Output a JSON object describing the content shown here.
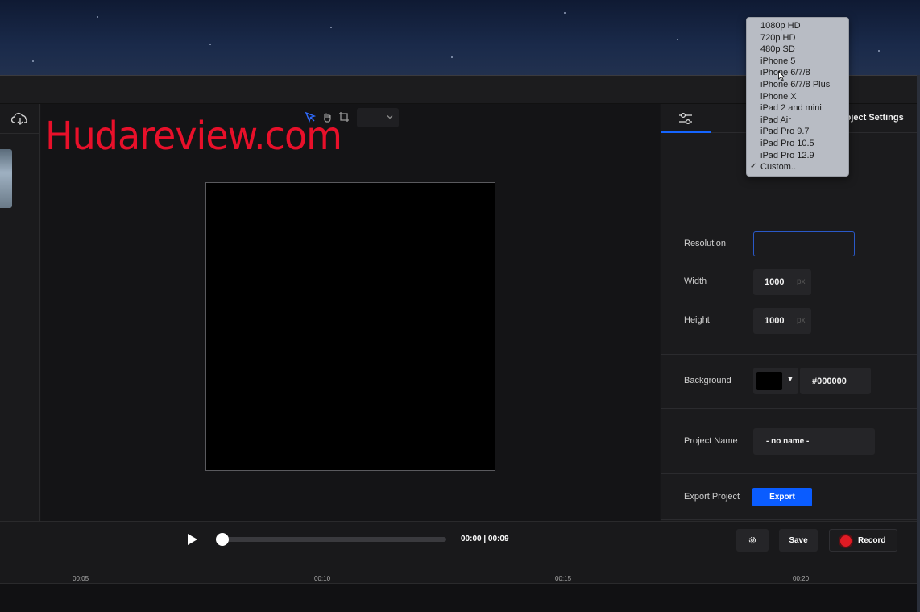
{
  "watermark": "Hudareview.com",
  "panel": {
    "tab_label": "Project Settings",
    "resolution_label": "Resolution",
    "width_label": "Width",
    "width_value": "1000",
    "height_label": "Height",
    "height_value": "1000",
    "unit": "px",
    "background_label": "Background",
    "background_hex": "#000000",
    "project_name_label": "Project Name",
    "project_name_value": "- no name -",
    "export_label": "Export Project",
    "export_button": "Export"
  },
  "resolution_menu": {
    "selected": "Custom..",
    "check_glyph": "✓",
    "options": [
      "1080p HD",
      "720p HD",
      "480p SD",
      "iPhone 5",
      "iPhone 6/7/8",
      "iPhone 6/7/8 Plus",
      "iPhone X",
      "iPad 2 and mini",
      "iPad Air",
      "iPad Pro 9.7",
      "iPad Pro 10.5",
      "iPad Pro 12.9",
      "Custom.."
    ]
  },
  "transport": {
    "time": "00:00 | 00:09",
    "save_label": "Save",
    "record_label": "Record",
    "progress": 0
  },
  "timeline": {
    "ticks": [
      "00:05",
      "00:10",
      "00:15",
      "00:20"
    ]
  },
  "colors": {
    "accent": "#0a5cff",
    "record": "#e01b24",
    "watermark": "#e8102a",
    "canvas_background": "#000000"
  },
  "icons": {
    "upload": "cloud-upload-icon",
    "select": "select-arrow-icon",
    "pan": "hand-icon",
    "crop": "crop-icon",
    "settings": "sliders-icon",
    "play": "play-icon",
    "gear": "gear-icon"
  }
}
